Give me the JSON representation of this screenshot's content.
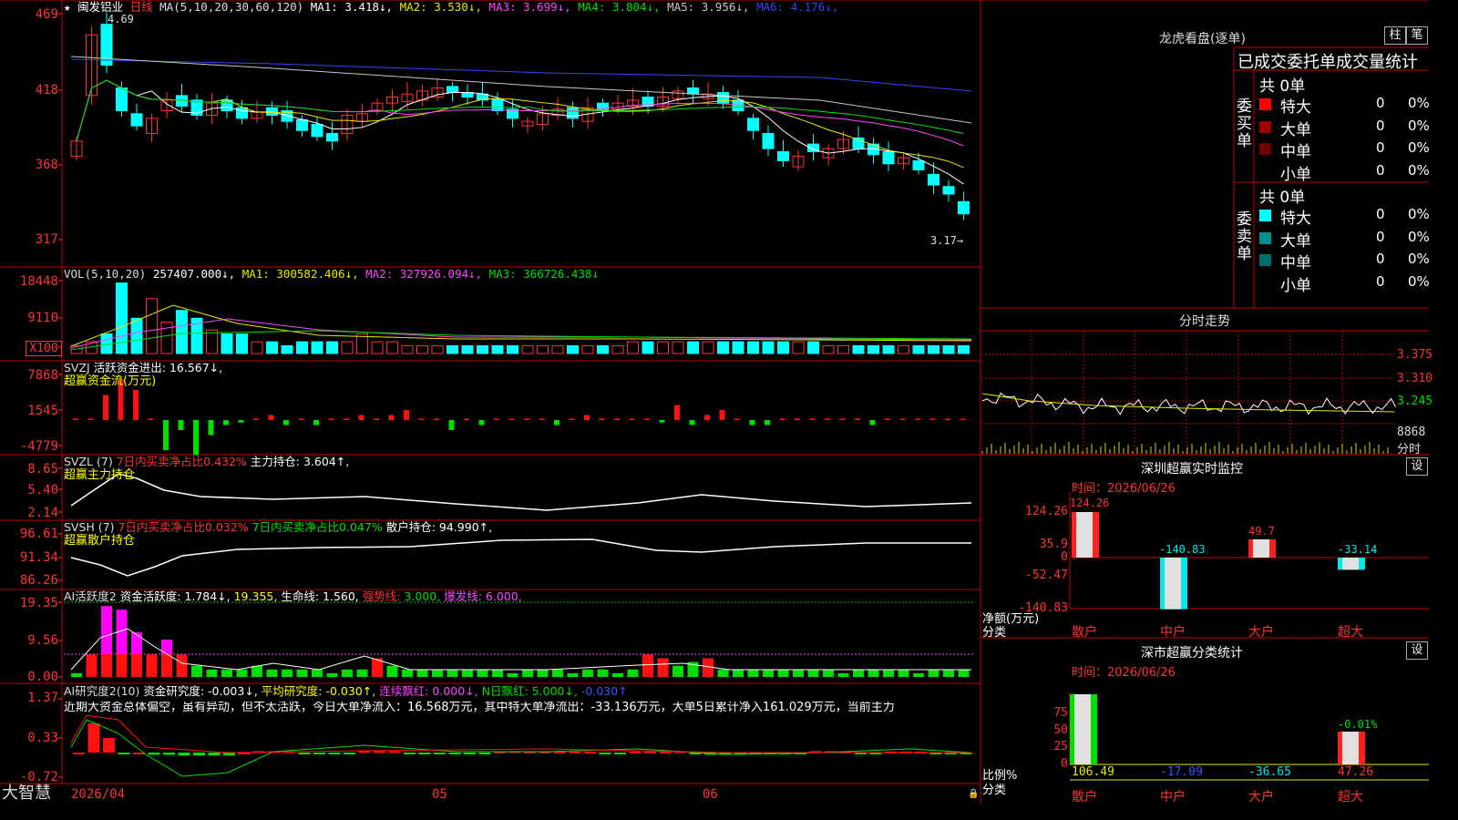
{
  "brand": "大智慧",
  "stock": {
    "star": "★",
    "name": "闽发铝业",
    "period": "日线"
  },
  "k_panel": {
    "ma_label": "MA(5,10,20,30,60,120)",
    "ma": [
      {
        "label": "MA1:",
        "value": "3.418↓",
        "color": "#ffffff"
      },
      {
        "label": "MA2:",
        "value": "3.530↓",
        "color": "#e8e800"
      },
      {
        "label": "MA3:",
        "value": "3.699↓",
        "color": "#ff44ff"
      },
      {
        "label": "MA4:",
        "value": "3.804↓",
        "color": "#00e000"
      },
      {
        "label": "MA5:",
        "value": "3.956↓",
        "color": "#c8c8c8"
      },
      {
        "label": "MA6:",
        "value": "4.176↓",
        "color": "#3344ff"
      }
    ],
    "y_ticks": [
      "469",
      "418",
      "368",
      "317"
    ],
    "high_mark": "4.69",
    "low_mark": "3.17"
  },
  "vol_panel": {
    "label": "VOL(5,10,20)",
    "value": "257407.000↓,",
    "ma": [
      {
        "label": "MA1:",
        "value": "300582.406↓,",
        "color": "#e8e800"
      },
      {
        "label": "MA2:",
        "value": "327926.094↓,",
        "color": "#ff44ff"
      },
      {
        "label": "MA3:",
        "value": "366726.438↓",
        "color": "#00e000"
      }
    ],
    "y_ticks": [
      "18448",
      "9110"
    ],
    "unit": "X100"
  },
  "svzj_panel": {
    "label": "SVZJ",
    "desc": "活跃资金进出:",
    "value": "16.567↓,",
    "title": "超赢资金流(万元)",
    "y_ticks": [
      "7868",
      "1545",
      "-4779"
    ]
  },
  "svzl_panel": {
    "label": "SVZL (7)",
    "ratio_text": "7日内买卖净占比0.432%",
    "hold_text": "主力持仓:",
    "hold_value": "3.604↑,",
    "title": "超赢主力持仓",
    "y_ticks": [
      "8.65",
      "5.40",
      "2.14"
    ]
  },
  "svsh_panel": {
    "label": "SVSH (7)",
    "ratio1": "7日内买卖净占比0.032%",
    "ratio2": "7日内买卖净占比0.047%",
    "hold_text": "散户持仓:",
    "hold_value": "94.990↑,",
    "title": "超赢散户持仓",
    "y_ticks": [
      "96.61",
      "91.34",
      "86.26"
    ]
  },
  "ai_active_panel": {
    "label": "AI活跃度2",
    "fund_text": "资金活跃度:",
    "fund_value": "1.784↓,",
    "second_value": "19.355,",
    "life_text": "生命线:",
    "life_value": "1.560,",
    "strong_text": "强势线:",
    "strong_value": "3.000,",
    "burst_text": "爆发线:",
    "burst_value": "6.000,",
    "y_ticks": [
      "19.35",
      "9.56",
      "0.00"
    ]
  },
  "ai_research_panel": {
    "label": "AI研究度2(10)",
    "fund_text": "资金研究度:",
    "fund_value": "-0.003↓,",
    "avg_text": "平均研究度:",
    "avg_value": "-0.030↑,",
    "cont_text": "连续飘红:",
    "cont_value": "0.000↓,",
    "nday_text": "N日飘红:",
    "nday_value": "5.000↓,",
    "last_value": "-0.030↑",
    "comment": "近期大资金总体偏空，虽有异动，但不太活跃，今日大单净流入：16.568万元，其中特大单净流出：-33.136万元，大单5日累计净入161.029万元，当前主力",
    "y_ticks": [
      "1.37",
      "0.33",
      "-0.72"
    ]
  },
  "x_axis": [
    "2026/04",
    "05",
    "06"
  ],
  "right_panel": {
    "title": "龙虎看盘(逐单)",
    "btn_zhu": "柱",
    "btn_bi": "笔",
    "order_title": "已成交委托单成交量统计",
    "buy_label": "委买单",
    "sell_label": "委卖单",
    "buy_total": "共 0单",
    "sell_total": "共 0单",
    "buy_rows": [
      {
        "name": "特大",
        "count": "0",
        "pct": "0%",
        "color": "#ff0000"
      },
      {
        "name": "大单",
        "count": "0",
        "pct": "0%",
        "color": "#a00000"
      },
      {
        "name": "中单",
        "count": "0",
        "pct": "0%",
        "color": "#700000"
      },
      {
        "name": "小单",
        "count": "0",
        "pct": "0%",
        "color": ""
      }
    ],
    "sell_rows": [
      {
        "name": "特大",
        "count": "0",
        "pct": "0%",
        "color": "#00ffff"
      },
      {
        "name": "大单",
        "count": "0",
        "pct": "0%",
        "color": "#009090"
      },
      {
        "name": "中单",
        "count": "0",
        "pct": "0%",
        "color": "#006e6e"
      },
      {
        "name": "小单",
        "count": "0",
        "pct": "0%",
        "color": ""
      }
    ],
    "intraday_title": "分时走势",
    "intraday_ticks": [
      "3.375",
      "3.310",
      "3.245"
    ],
    "intraday_vol": "8868",
    "intraday_label": "分时",
    "monitor": {
      "title": "深圳超赢实时监控",
      "set_btn": "设",
      "time": "时间：2026/06/26",
      "y_ticks": [
        "124.26",
        "35.9",
        "0",
        "-52.47",
        "-140.83"
      ],
      "y_unit": "净额(万元)",
      "x_unit": "分类",
      "categories": [
        "散户",
        "中户",
        "大户",
        "超大"
      ],
      "values": [
        124.26,
        -140.83,
        49.7,
        -33.14
      ],
      "labels": [
        "124.26",
        "-140.83",
        "49.7",
        "-33.14"
      ]
    },
    "stats": {
      "title": "深市超赢分类统计",
      "set_btn": "设",
      "time": "时间：2026/06/26",
      "y_ticks": [
        "75",
        "50",
        "25",
        "0"
      ],
      "y_unit": "比例%",
      "x_unit": "分类",
      "categories": [
        "散户",
        "中户",
        "大户",
        "超大"
      ],
      "values": [
        106.49,
        -17.09,
        -36.65,
        47.26
      ],
      "labels": [
        "106.49",
        "-17.09",
        "-36.65",
        "47.26"
      ],
      "extra_label": "-0.01%"
    }
  }
}
